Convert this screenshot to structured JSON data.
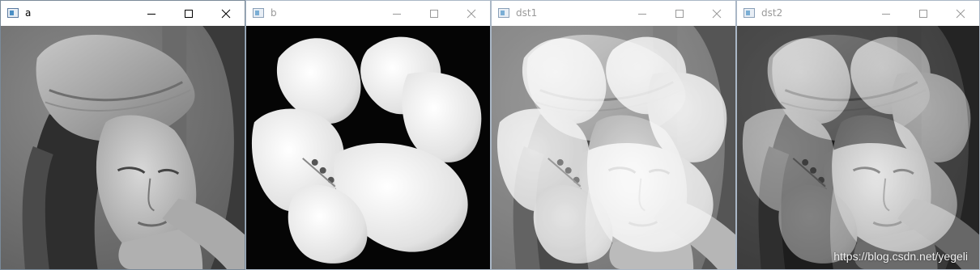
{
  "windows": [
    {
      "title": "a",
      "active": true
    },
    {
      "title": "b",
      "active": false
    },
    {
      "title": "dst1",
      "active": false
    },
    {
      "title": "dst2",
      "active": false
    }
  ],
  "icons": {
    "app": "opencv-window-icon",
    "minimize": "minimize-icon",
    "maximize": "maximize-icon",
    "close": "close-icon"
  },
  "watermark": "https://blog.csdn.net/yegeli"
}
